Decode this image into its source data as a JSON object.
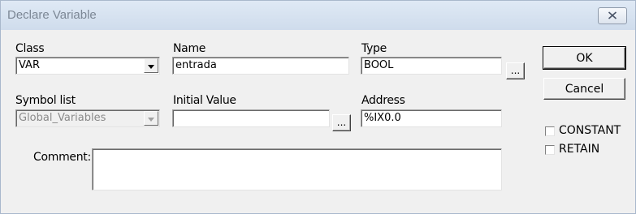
{
  "window": {
    "title": "Declare Variable"
  },
  "class": {
    "label": "Class",
    "value": "VAR"
  },
  "name": {
    "label": "Name",
    "value": "entrada"
  },
  "type": {
    "label": "Type",
    "value": "BOOL",
    "browse_label": "..."
  },
  "symbol_list": {
    "label": "Symbol list",
    "value": "Global_Variables"
  },
  "initial_value": {
    "label": "Initial Value",
    "value": "",
    "browse_label": "..."
  },
  "address": {
    "label": "Address",
    "value": "%IX0.0"
  },
  "comment": {
    "label": "Comment:",
    "value": ""
  },
  "buttons": {
    "ok": "OK",
    "cancel": "Cancel"
  },
  "options": {
    "constant": {
      "label": "CONSTANT",
      "checked": false
    },
    "retain": {
      "label": "RETAIN",
      "checked": false
    }
  },
  "icons": {
    "close": "close-icon",
    "dropdown": "chevron-down-icon"
  }
}
